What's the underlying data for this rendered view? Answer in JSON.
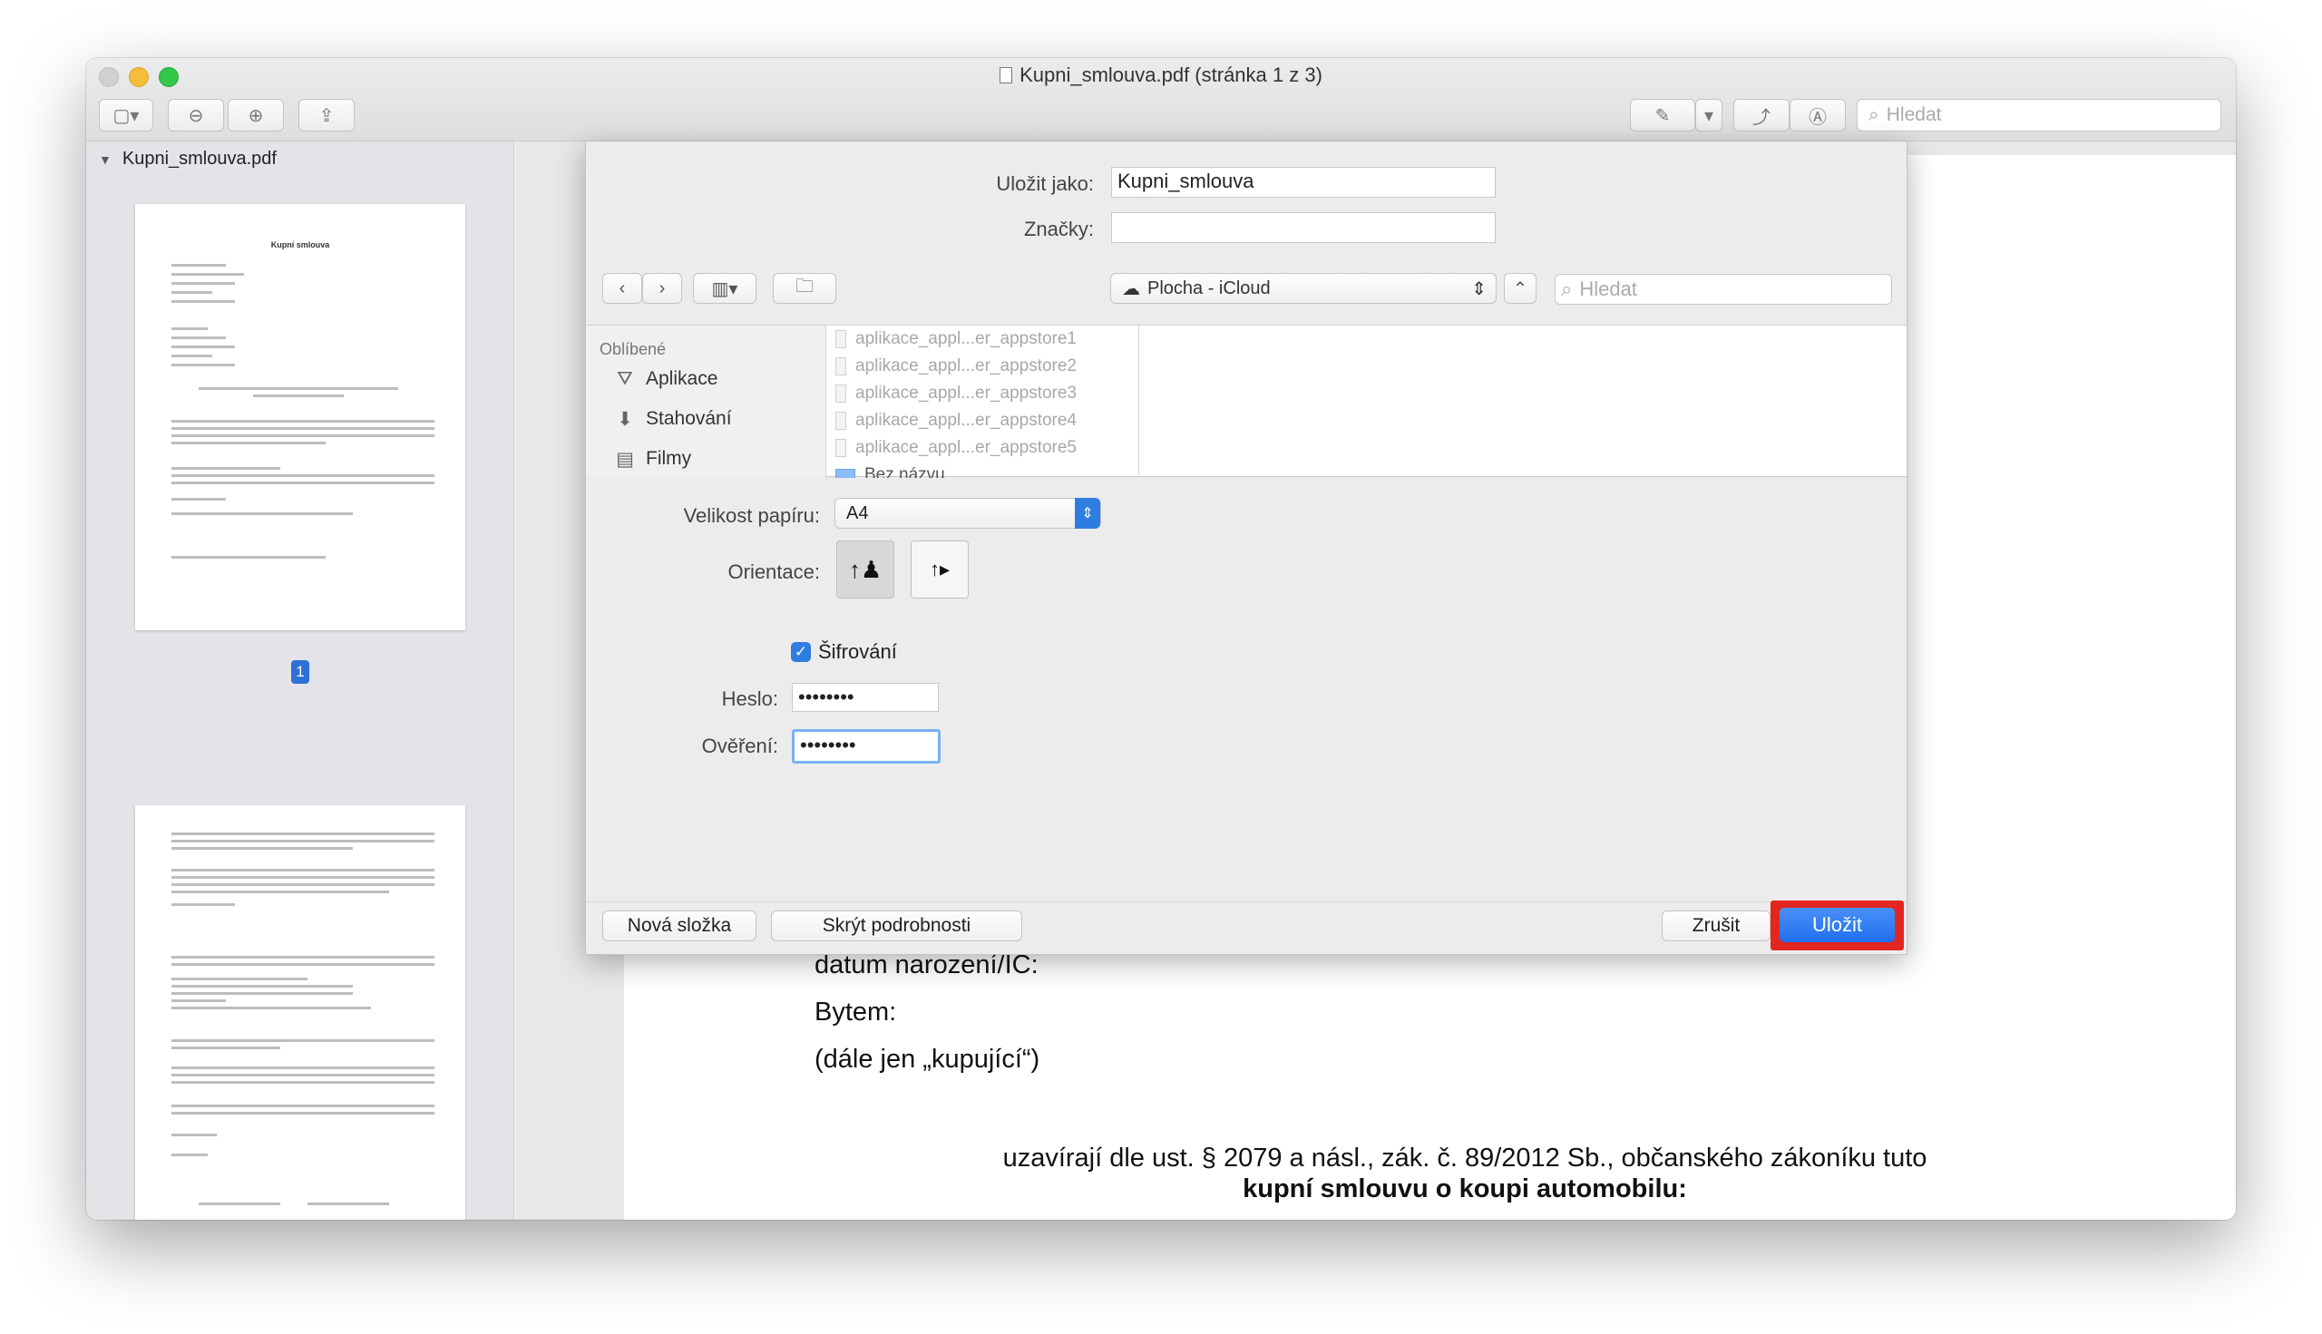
{
  "window": {
    "title": "Kupni_smlouva.pdf (stránka 1 z 3)",
    "search_placeholder": "Hledat"
  },
  "sidebar": {
    "file_name": "Kupni_smlouva.pdf",
    "thumbnail_title": "Kupní smlouva",
    "current_page": "1"
  },
  "document": {
    "lines": [
      "datum narození/IČ:",
      "Bytem:",
      "(dále jen „kupující“)"
    ],
    "para_1": "uzavírají dle ust. § 2079 a násl., zák. č. 89/2012 Sb., občanského zákoníku tuto",
    "para_2": "kupní smlouvu o koupi automobilu:"
  },
  "save_dialog": {
    "save_as_label": "Uložit jako:",
    "save_as_value": "Kupni_smlouva",
    "tags_label": "Značky:",
    "tags_value": "",
    "location": "Plocha - iCloud",
    "search_placeholder": "Hledat",
    "favorites_title": "Oblíbené",
    "favorites": [
      {
        "label": "Aplikace",
        "icon": "applications-icon"
      },
      {
        "label": "Stahování",
        "icon": "downloads-icon"
      },
      {
        "label": "Filmy",
        "icon": "movies-icon"
      }
    ],
    "files": [
      "aplikace_appl...er_appstore1",
      "aplikace_appl...er_appstore2",
      "aplikace_appl...er_appstore3",
      "aplikace_appl...er_appstore4",
      "aplikace_appl...er_appstore5",
      "Bez názvu"
    ],
    "paper_size_label": "Velikost papíru:",
    "paper_size_value": "A4",
    "orientation_label": "Orientace:",
    "encryption_label": "Šifrování",
    "encryption_checked": true,
    "password_label": "Heslo:",
    "password_value": "••••••••",
    "verify_label": "Ověření:",
    "verify_value": "••••••••",
    "new_folder_button": "Nová složka",
    "hide_details_button": "Skrýt podrobnosti",
    "cancel_button": "Zrušit",
    "save_button": "Uložit"
  },
  "colors": {
    "accent": "#2f7de1",
    "highlight": "#e1271f"
  }
}
